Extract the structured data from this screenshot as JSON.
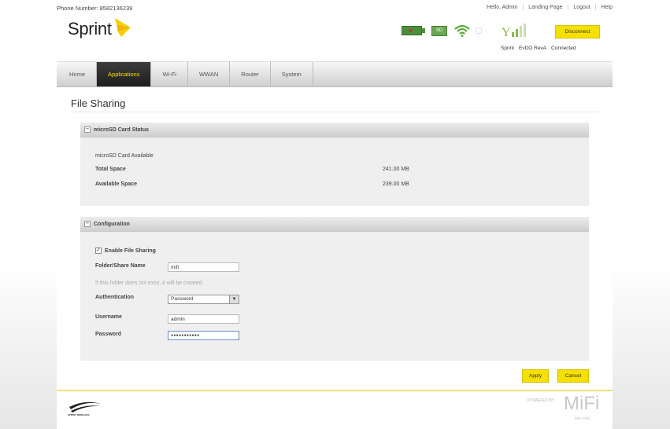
{
  "header": {
    "phone_number": "Phone Number: 8582136239",
    "greeting": "Hello, Admin",
    "links": [
      "Landing Page",
      "Logout",
      "Help"
    ],
    "logo_text": "Sprint"
  },
  "status": {
    "sd_label": "SD",
    "disconnect_label": "Disconnect",
    "carrier": "Sprint",
    "technology": "EvDO RevA",
    "connection": "Connected"
  },
  "nav": {
    "tabs": [
      "Home",
      "Applications",
      "Wi-Fi",
      "WWAN",
      "Router",
      "System"
    ],
    "active": "Applications"
  },
  "page": {
    "title": "File Sharing"
  },
  "sd_status": {
    "header": "microSD Card Status",
    "availability": "microSD Card Available",
    "total_label": "Total Space",
    "total_value": "241.00 MB",
    "available_label": "Available Space",
    "available_value": "239.00 MB"
  },
  "configuration": {
    "header": "Configuration",
    "enable_label": "Enable File Sharing",
    "enable_checked": true,
    "share_name_label": "Folder/Share Name",
    "share_name_value": "mifi",
    "hint": "If this folder does not exist, it will be created.",
    "auth_label": "Authentication",
    "auth_value": "Password",
    "username_label": "Username",
    "username_value": "admin",
    "password_label": "Password",
    "password_value": "●●●●●●●●●●●"
  },
  "buttons": {
    "apply": "Apply",
    "cancel": "Cancel"
  },
  "footer": {
    "brand_small": "SPRINT WIRELESS",
    "powered_by": "POWERED BY",
    "mifi": "MiFi",
    "model": "MiFi 4082"
  },
  "colors": {
    "accent_yellow": "#f6e000",
    "nav_active_bg": "#2a2a2a",
    "panel_bg": "#efefef"
  }
}
